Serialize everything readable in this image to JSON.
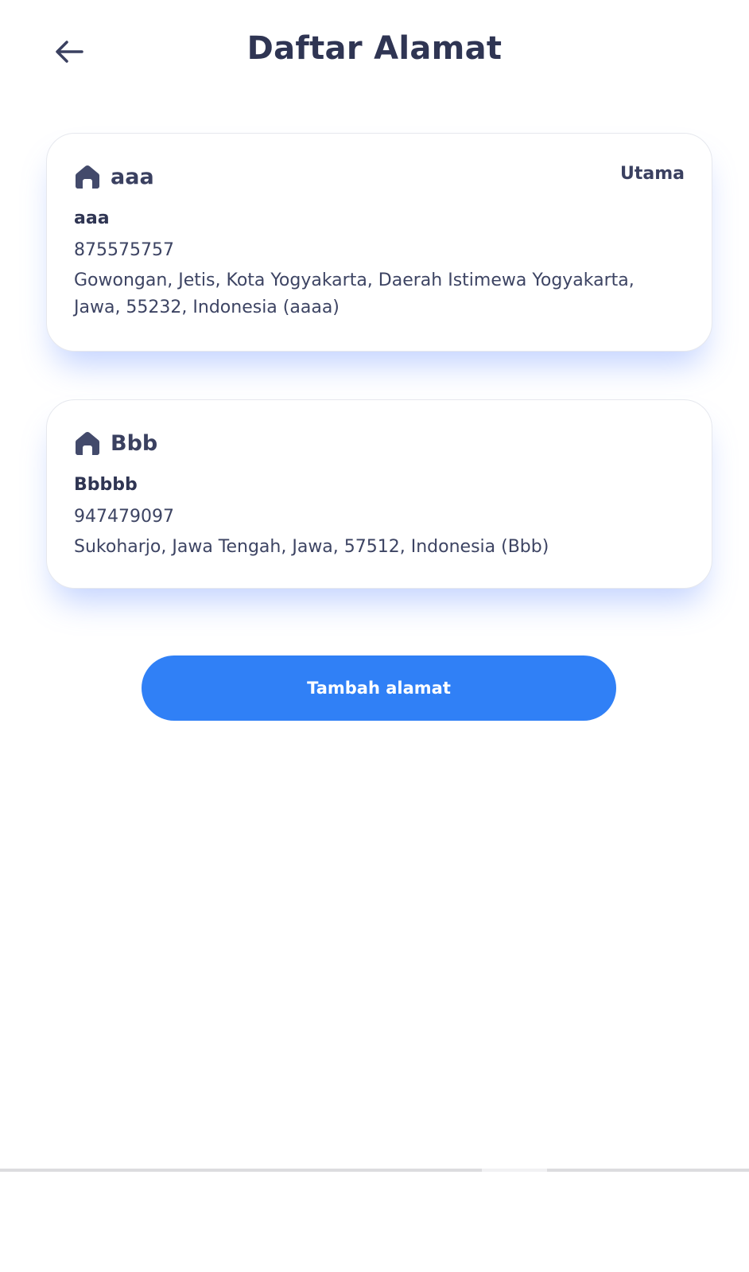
{
  "header": {
    "title": "Daftar Alamat",
    "back_icon": "arrow-left-icon"
  },
  "addresses": [
    {
      "label": "aaa",
      "badge": "Utama",
      "recipient": "aaa",
      "phone": "875575757",
      "address": "Gowongan, Jetis, Kota Yogyakarta, Daerah Istimewa Yogyakarta, Jawa, 55232, Indonesia (aaaa)",
      "icon": "home-icon"
    },
    {
      "label": "Bbb",
      "recipient": "Bbbbb",
      "phone": "947479097",
      "address": "Sukoharjo, Jawa Tengah, Jawa, 57512, Indonesia (Bbb)",
      "icon": "home-icon"
    }
  ],
  "actions": {
    "add_address_label": "Tambah alamat"
  },
  "colors": {
    "primary": "#3080f6",
    "text_dark": "#2f3553",
    "icon": "#434a6b"
  }
}
